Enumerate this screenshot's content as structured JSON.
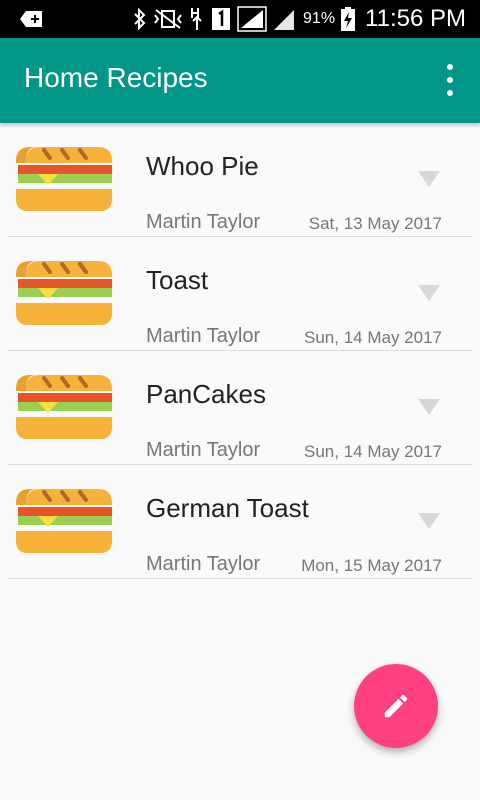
{
  "status_bar": {
    "battery_percent": "91%",
    "time": "11:56 PM",
    "icons": [
      "notification-add-icon",
      "bluetooth-icon",
      "vibrate-icon",
      "data-activity-icon",
      "sim-1-icon",
      "signal-icon",
      "signal-2-icon",
      "battery-charging-icon"
    ]
  },
  "app_bar": {
    "title": "Home Recipes",
    "color": "#009688",
    "menu_icon": "overflow-menu-icon"
  },
  "recipes": [
    {
      "name": "Whoo Pie",
      "author": "Martin Taylor",
      "date": "Sat, 13 May 2017",
      "icon": "sandwich-icon"
    },
    {
      "name": "Toast",
      "author": "Martin Taylor",
      "date": "Sun, 14 May 2017",
      "icon": "sandwich-icon"
    },
    {
      "name": "PanCakes",
      "author": "Martin Taylor",
      "date": "Sun, 14 May 2017",
      "icon": "sandwich-icon"
    },
    {
      "name": "German Toast",
      "author": "Martin Taylor",
      "date": "Mon, 15 May 2017",
      "icon": "sandwich-icon"
    }
  ],
  "fab": {
    "icon": "edit-pencil-icon",
    "color": "#ff4081"
  }
}
